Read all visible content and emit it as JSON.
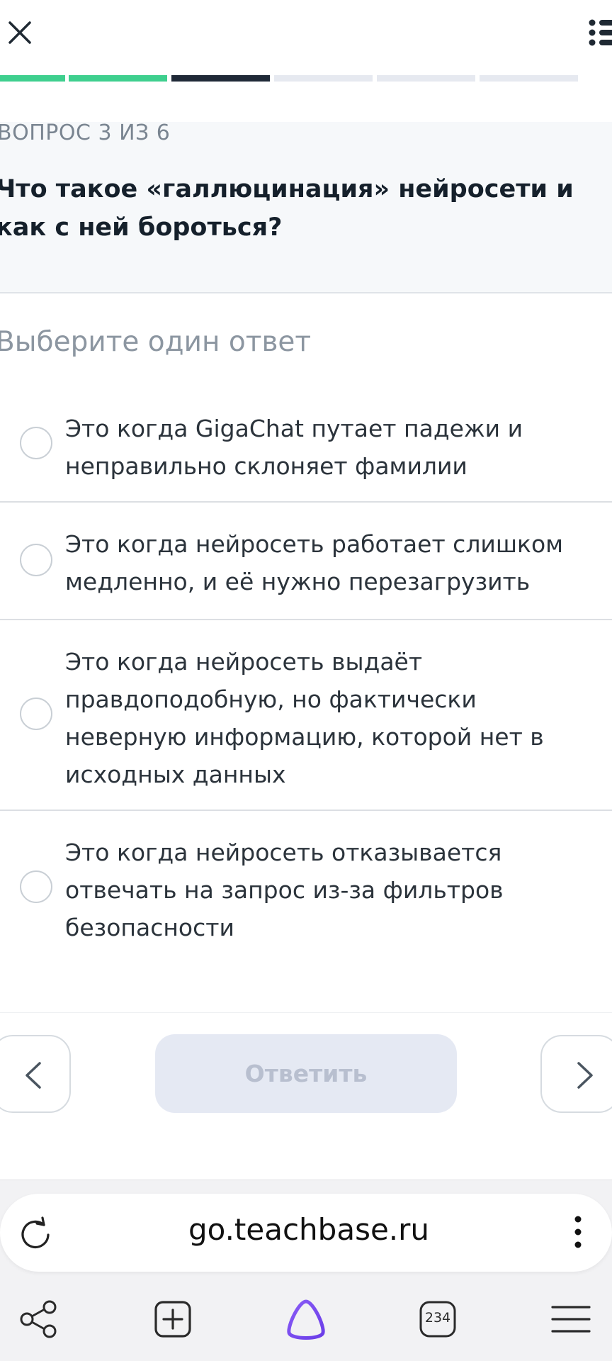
{
  "progress": {
    "current": 3,
    "total": 6,
    "segments": [
      "done",
      "done",
      "current",
      "todo",
      "todo",
      "todo"
    ],
    "colors": {
      "done": "#3ecf8e",
      "current": "#1f2937",
      "todo": "#e6e9f0"
    }
  },
  "question": {
    "counter": "ВОПРОС 3 ИЗ 6",
    "text": "Что такое «галлюцинация» нейросети и как с ней бороться?"
  },
  "answers": {
    "hint": "Выберите один ответ",
    "options": [
      {
        "text": "Это когда GigaChat путает падежи и неправильно склоняет фамилии",
        "selected": false
      },
      {
        "text": "Это когда нейросеть работает слишком медленно, и её нужно перезагрузить",
        "selected": false
      },
      {
        "text": "Это когда нейросеть выдаёт правдоподобную, но фактически неверную информацию, которой нет в исходных данных",
        "selected": false
      },
      {
        "text": "Это когда нейросеть отказывается отвечать на запрос из-за фильтров безопасности",
        "selected": false
      }
    ]
  },
  "navigation": {
    "submit_label": "Ответить",
    "submit_enabled": false
  },
  "browser": {
    "url": "go.teachbase.ru",
    "tabs_count": "234",
    "icons": {
      "reload": "reload-icon",
      "more": "more-vertical-icon",
      "share": "share-icon",
      "new_tab": "new-tab-icon",
      "assistant": "alice-assistant-icon",
      "tabs": "tabs-counter-icon",
      "menu": "hamburger-menu-icon"
    }
  }
}
